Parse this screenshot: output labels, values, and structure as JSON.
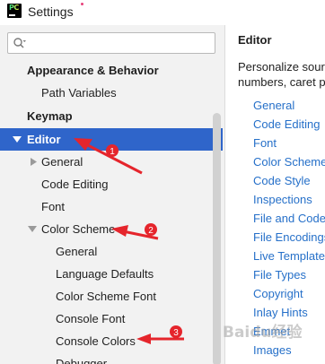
{
  "window": {
    "title": "Settings"
  },
  "search": {
    "placeholder": "",
    "value": ""
  },
  "tree": {
    "appearance_behavior": "Appearance & Behavior",
    "path_variables": "Path Variables",
    "keymap": "Keymap",
    "editor": "Editor",
    "general": "General",
    "code_editing": "Code Editing",
    "font": "Font",
    "color_scheme": "Color Scheme",
    "cs_general": "General",
    "language_defaults": "Language Defaults",
    "color_scheme_font": "Color Scheme Font",
    "console_font": "Console Font",
    "console_colors": "Console Colors",
    "debugger": "Debugger"
  },
  "editor_panel": {
    "title": "Editor",
    "description_line1": "Personalize source",
    "description_line2": "numbers, caret p",
    "links": [
      "General",
      "Code Editing",
      "Font",
      "Color Scheme",
      "Code Style",
      "Inspections",
      "File and Code",
      "File Encodings",
      "Live Template",
      "File Types",
      "Copyright",
      "Inlay Hints",
      "Emmet",
      "Images"
    ]
  },
  "annotations": {
    "marker_1": "1",
    "marker_2": "2",
    "marker_3": "3"
  },
  "watermark": "Baidu经验",
  "colors": {
    "selection": "#2f65ca",
    "link": "#2670c9",
    "annotation": "#e5252c",
    "sidebar_bg": "#f2f2f2"
  }
}
